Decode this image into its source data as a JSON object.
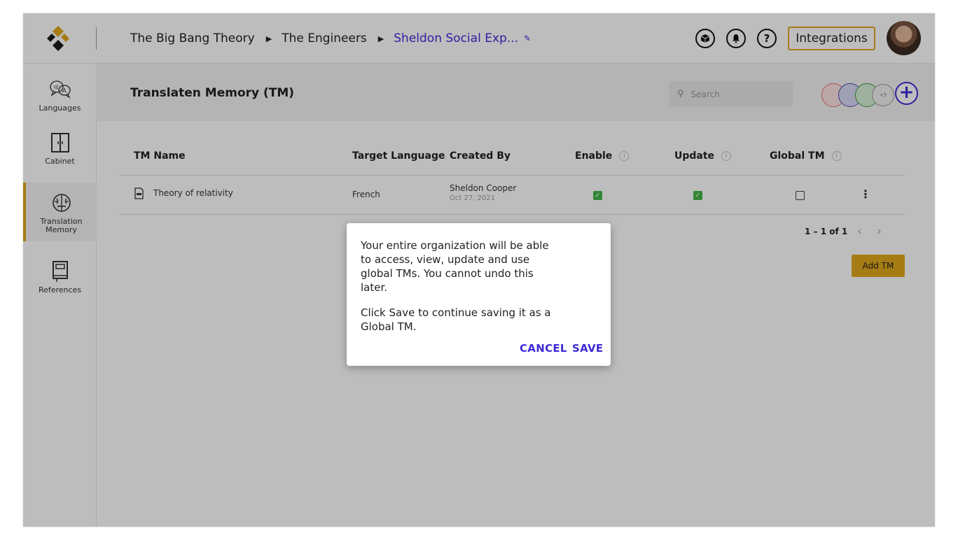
{
  "header": {
    "breadcrumbs": [
      "The Big Bang Theory",
      "The Engineers",
      "Sheldon Social Exp..."
    ],
    "integrations_label": "Integrations"
  },
  "sidebar": {
    "items": [
      {
        "label": "Languages",
        "icon": "languages-icon"
      },
      {
        "label": "Cabinet",
        "icon": "cabinet-icon"
      },
      {
        "label": "Translation Memory",
        "icon": "brain-icon",
        "active": true
      },
      {
        "label": "References",
        "icon": "book-icon"
      }
    ]
  },
  "main": {
    "title": "Translaten Memory (TM)",
    "search_placeholder": "Search",
    "collaborators_more": "+5",
    "columns": [
      "TM Name",
      "Target Language",
      "Created By",
      "Enable",
      "Update",
      "Global TM"
    ],
    "rows": [
      {
        "name": "Theory of relativity",
        "target_language": "French",
        "created_by": "Sheldon Cooper",
        "created_on": "Oct 27, 2021",
        "enable": true,
        "update": true,
        "global_tm": false
      }
    ],
    "pagination": "1 – 1 of 1",
    "add_button": "Add TM"
  },
  "dialog": {
    "message": "Your entire organization will be able to access, view, update and use global TMs. You cannot undo this later.",
    "message2": "Click Save to continue saving it as a Global TM.",
    "cancel_label": "CANCEL",
    "save_label": "SAVE"
  },
  "colors": {
    "accent": "#3e2bd8",
    "brand_gold": "#e0a81c",
    "check_green": "#46b54a"
  }
}
